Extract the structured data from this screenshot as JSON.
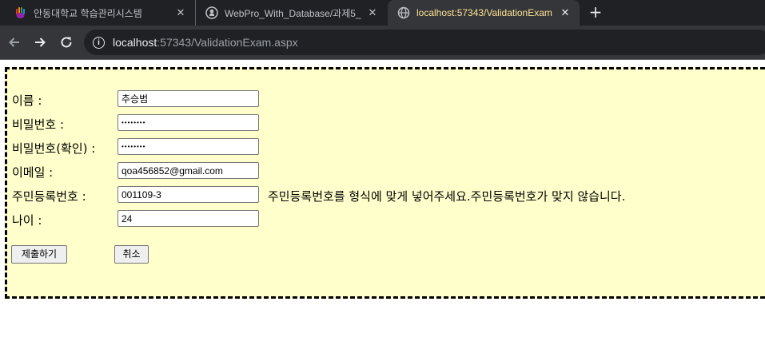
{
  "browser": {
    "tabs": [
      {
        "title": "안동대학교 학습관리시스템",
        "icon": "colorful-hand-icon",
        "active": false
      },
      {
        "title": "WebPro_With_Database/과제5_",
        "icon": "github-icon",
        "active": false
      },
      {
        "title": "localhost:57343/ValidationExam",
        "icon": "globe-icon",
        "active": true
      }
    ],
    "new_tab_label": "+",
    "close_glyph": "✕",
    "url_host": "localhost",
    "url_path": ":57343/ValidationExam.aspx",
    "colors": {
      "tabbar": "#202124",
      "toolbar": "#35363a",
      "active_tab_text": "#fde293"
    }
  },
  "form": {
    "background": "#ffffcc",
    "fields": [
      {
        "label": "이름 :",
        "value": "추승범",
        "type": "text"
      },
      {
        "label": "비밀번호 :",
        "value": "••••••••",
        "type": "password"
      },
      {
        "label": "비밀번호(확인) :",
        "value": "••••••••",
        "type": "password"
      },
      {
        "label": "이메일 :",
        "value": "qoa456852@gmail.com",
        "type": "text"
      },
      {
        "label": "주민등록번호 :",
        "value": "001109-3",
        "type": "text",
        "error": "주민등록번호를 형식에 맞게 넣어주세요.주민등록번호가 맞지 않습니다."
      },
      {
        "label": "나이 :",
        "value": "24",
        "type": "text"
      }
    ],
    "submit_label": "제출하기",
    "cancel_label": "취소"
  }
}
